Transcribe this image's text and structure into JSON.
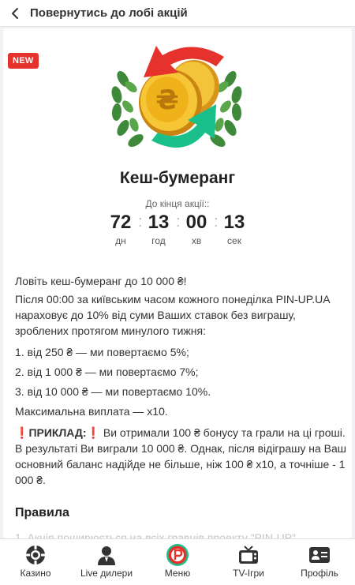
{
  "header": {
    "back_label": "Повернутись до лобі акцій"
  },
  "promo": {
    "badge": "NEW",
    "title": "Кеш-бумеранг",
    "countdown_label": "До кінця акції::",
    "countdown": [
      {
        "value": "72",
        "unit": "дн"
      },
      {
        "value": "13",
        "unit": "год"
      },
      {
        "value": "00",
        "unit": "хв"
      },
      {
        "value": "13",
        "unit": "сек"
      }
    ]
  },
  "content": {
    "intro1": "Ловіть кеш-бумеранг до 10 000 ₴!",
    "intro2": "Після 00:00 за київським часом кожного понеділка PIN-UP.UA нараховує до 10% від суми Ваших ставок без виграшу, зроблених протягом минулого тижня:",
    "list": [
      "1. від 250 ₴ — ми повертаємо 5%;",
      "2. від 1 000 ₴ — ми повертаємо 7%;",
      "3. від 10 000 ₴ — ми повертаємо 10%."
    ],
    "max_payout": "Максимальна виплата — x10.",
    "example_mark": "❗",
    "example_label": "ПРИКЛАД:",
    "example_mark2": "❗",
    "example_text": " Ви отримали 100 ₴ бонусу та грали на ці гроші. В результаті Ви виграли 10 000 ₴. Однак, після відіграшу на Ваш основний баланс надійде не більше, ніж 100 ₴ x10, а точніше - 1 000 ₴.",
    "rules_heading": "Правила",
    "faded_line": "1. Акція поширюється на всіх гравців проекту \"PIN-UP\"."
  },
  "nav": [
    {
      "label": "Казино",
      "icon": "casino-chip-icon"
    },
    {
      "label": "Live дилери",
      "icon": "live-dealer-icon"
    },
    {
      "label": "Меню",
      "icon": "pinup-logo-icon"
    },
    {
      "label": "TV-Ігри",
      "icon": "tv-icon"
    },
    {
      "label": "Профіль",
      "icon": "profile-card-icon"
    }
  ],
  "colors": {
    "accent_red": "#e5322d",
    "arrow_green": "#1bbf8a",
    "coin_gold": "#f0b21a"
  }
}
